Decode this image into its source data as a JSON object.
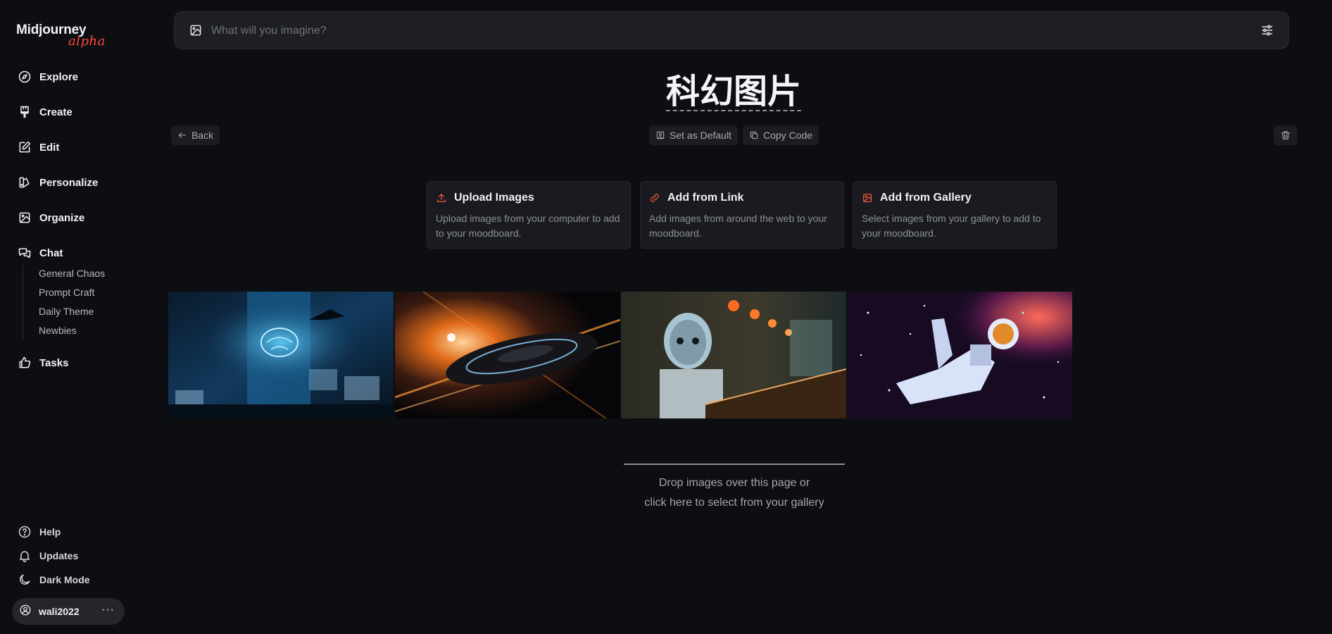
{
  "app": {
    "logo_name": "Midjourney",
    "logo_tag": "alpha"
  },
  "sidebar": {
    "items": [
      {
        "label": "Explore",
        "icon": "compass-icon"
      },
      {
        "label": "Create",
        "icon": "brush-icon"
      },
      {
        "label": "Edit",
        "icon": "edit-icon"
      },
      {
        "label": "Personalize",
        "icon": "palette-icon"
      },
      {
        "label": "Organize",
        "icon": "image-icon"
      },
      {
        "label": "Chat",
        "icon": "chat-icon"
      }
    ],
    "chat_channels": [
      "General Chaos",
      "Prompt Craft",
      "Daily Theme",
      "Newbies"
    ],
    "tasks_label": "Tasks",
    "bottom": {
      "help": "Help",
      "updates": "Updates",
      "dark_mode": "Dark Mode"
    },
    "user": {
      "name": "wali2022",
      "more": "···"
    }
  },
  "search": {
    "placeholder": "What will you imagine?",
    "value": ""
  },
  "moodboard": {
    "title": "科幻图片",
    "back": "Back",
    "set_default": "Set as Default",
    "copy_code": "Copy Code"
  },
  "cards": [
    {
      "title": "Upload Images",
      "desc": "Upload images from your computer to add to your moodboard."
    },
    {
      "title": "Add from Link",
      "desc": "Add images from around the web to your moodboard."
    },
    {
      "title": "Add from Gallery",
      "desc": "Select images from your gallery to add to your moodboard."
    }
  ],
  "dropzone": {
    "line1": "Drop images over this page or",
    "line2": "click here to select from your gallery"
  },
  "colors": {
    "accent": "#ff4a3d",
    "background": "#0d0e11",
    "panel": "#1e1f24"
  }
}
